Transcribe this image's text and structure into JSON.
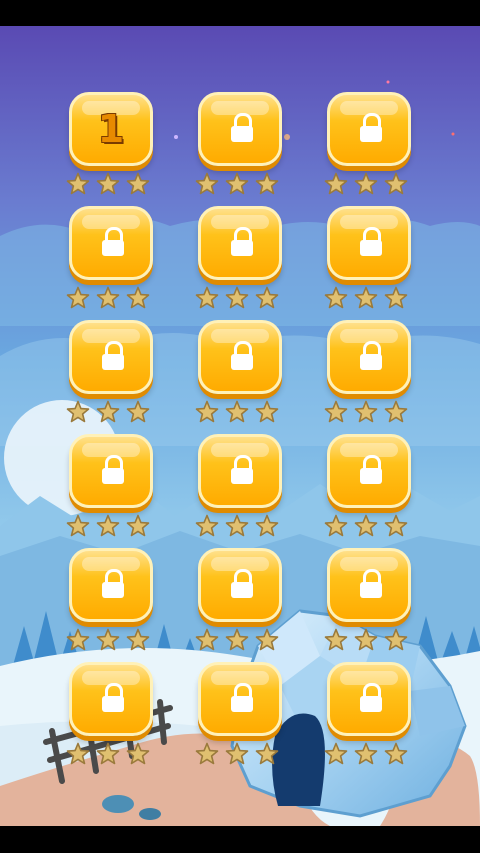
{
  "colors": {
    "sky_top": "#5c4bb5",
    "sky_mid": "#6aa9e0",
    "sky_bottom": "#a9dcf2",
    "button": "#ffc21a",
    "star": "#e0c070",
    "star_edge": "#9a7a3c",
    "snow": "#e9f5fb",
    "path": "#e3b39c",
    "ice": "#a9d4f2"
  },
  "levels": [
    {
      "label": "1",
      "state": "unlocked",
      "stars_earned": 0,
      "stars_total": 3
    },
    {
      "label": "",
      "state": "locked",
      "stars_earned": 0,
      "stars_total": 3
    },
    {
      "label": "",
      "state": "locked",
      "stars_earned": 0,
      "stars_total": 3
    },
    {
      "label": "",
      "state": "locked",
      "stars_earned": 0,
      "stars_total": 3
    },
    {
      "label": "",
      "state": "locked",
      "stars_earned": 0,
      "stars_total": 3
    },
    {
      "label": "",
      "state": "locked",
      "stars_earned": 0,
      "stars_total": 3
    },
    {
      "label": "",
      "state": "locked",
      "stars_earned": 0,
      "stars_total": 3
    },
    {
      "label": "",
      "state": "locked",
      "stars_earned": 0,
      "stars_total": 3
    },
    {
      "label": "",
      "state": "locked",
      "stars_earned": 0,
      "stars_total": 3
    },
    {
      "label": "",
      "state": "locked",
      "stars_earned": 0,
      "stars_total": 3
    },
    {
      "label": "",
      "state": "locked",
      "stars_earned": 0,
      "stars_total": 3
    },
    {
      "label": "",
      "state": "locked",
      "stars_earned": 0,
      "stars_total": 3
    },
    {
      "label": "",
      "state": "locked",
      "stars_earned": 0,
      "stars_total": 3
    },
    {
      "label": "",
      "state": "locked",
      "stars_earned": 0,
      "stars_total": 3
    },
    {
      "label": "",
      "state": "locked",
      "stars_earned": 0,
      "stars_total": 3
    },
    {
      "label": "",
      "state": "locked",
      "stars_earned": 0,
      "stars_total": 3
    },
    {
      "label": "",
      "state": "locked",
      "stars_earned": 0,
      "stars_total": 3
    },
    {
      "label": "",
      "state": "locked",
      "stars_earned": 0,
      "stars_total": 3
    }
  ]
}
